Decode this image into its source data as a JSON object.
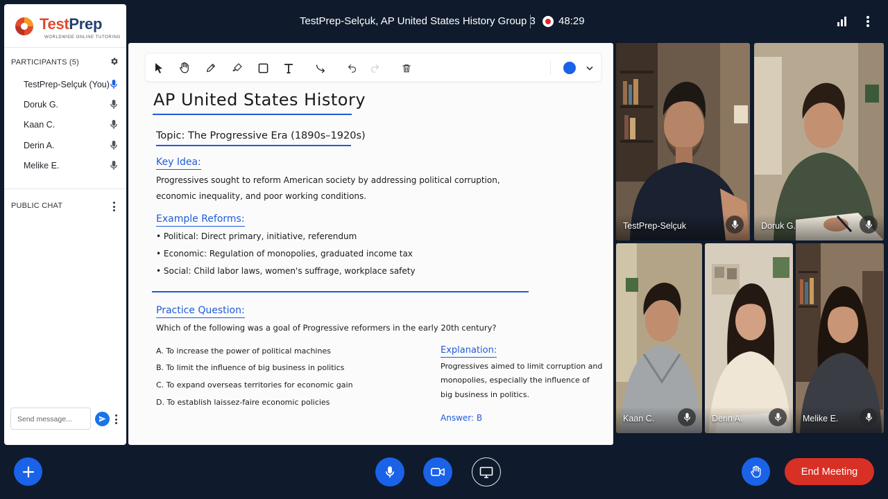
{
  "header": {
    "meeting_title": "TestPrep-Selçuk, AP United States History Group 3",
    "recording_time": "48:29"
  },
  "brand": {
    "name_part1": "Test",
    "name_part2": "Prep",
    "tagline": "WORLDWIDE ONLINE TUTORING"
  },
  "sidebar": {
    "participants_title": "PARTICIPANTS (5)",
    "participants": [
      {
        "name": "TestPrep-Selçuk (You)",
        "mic_active": true
      },
      {
        "name": "Doruk G.",
        "mic_active": false
      },
      {
        "name": "Kaan C.",
        "mic_active": false
      },
      {
        "name": "Derin A.",
        "mic_active": false
      },
      {
        "name": "Melike E.",
        "mic_active": false
      }
    ],
    "chat_title": "PUBLIC CHAT",
    "chat_placeholder": "Send message..."
  },
  "whiteboard": {
    "selected_color": "#1a62e8",
    "title": "AP United States History",
    "topic": "Topic: The Progressive Era (1890s–1920s)",
    "key_idea_heading": "Key Idea:",
    "key_idea_line1": "Progressives sought to reform American society by addressing political corruption,",
    "key_idea_line2": "economic inequality, and poor working conditions.",
    "reforms_heading": "Example Reforms:",
    "reforms": [
      "• Political: Direct primary, initiative, referendum",
      "• Economic: Regulation of monopolies, graduated income tax",
      "• Social: Child labor laws, women's suffrage, workplace safety"
    ],
    "practice_heading": "Practice Question:",
    "question": "Which of the following was a goal of Progressive reformers in the early 20th century?",
    "options": [
      "A. To increase the power of political machines",
      "B. To limit the influence of big business in politics",
      "C. To expand overseas territories for economic gain",
      "D. To establish laissez-faire economic policies"
    ],
    "explanation_heading": "Explanation:",
    "explanation_lines": [
      "Progressives aimed to limit corruption and",
      "monopolies, especially the influence of",
      "big business in politics."
    ],
    "answer": "Answer: B"
  },
  "videos": [
    {
      "name": "TestPrep-Selçuk"
    },
    {
      "name": "Doruk G."
    },
    {
      "name": "Kaan C."
    },
    {
      "name": "Derin A."
    },
    {
      "name": "Melike E."
    }
  ],
  "footer": {
    "end_meeting_label": "End Meeting"
  },
  "colors": {
    "accent": "#1a62e8",
    "end_meeting": "#d93025",
    "background": "#0f1a2c"
  }
}
